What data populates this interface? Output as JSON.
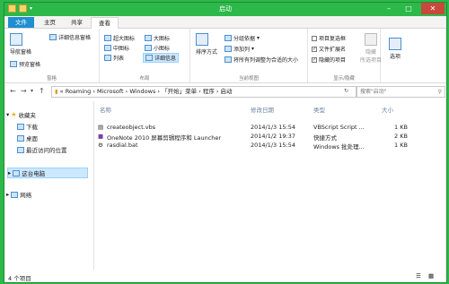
{
  "window": {
    "title": "启动"
  },
  "tabs": [
    "文件",
    "主页",
    "共享",
    "查看"
  ],
  "ribbon": {
    "pane": {
      "nav_pane": "导航窗格",
      "preview": "预览窗格",
      "details": "详细信息窗格",
      "label": "窗格"
    },
    "layout": {
      "items": [
        "超大图标",
        "大图标",
        "中图标",
        "小图标",
        "列表",
        "详细信息"
      ],
      "label": "布局"
    },
    "current_view": {
      "sort": "排序方式",
      "group": "分组依据",
      "add_col": "添加列",
      "fit_cols": "将所有列调整为合适的大小",
      "label": "当前视图"
    },
    "show_hide": {
      "item_checkbox": "项目复选框",
      "ext": "文件扩展名",
      "hidden": "隐藏的项目",
      "hide_selected": "隐藏\n所选项目",
      "label": "显示/隐藏"
    },
    "options": "选项"
  },
  "address": {
    "segments": [
      "Roaming",
      "Microsoft",
      "Windows",
      "「开始」菜单",
      "程序",
      "启动"
    ],
    "search_placeholder": "搜索\"启动\""
  },
  "nav": {
    "favorites": "收藏夹",
    "downloads": "下载",
    "desktop": "桌面",
    "recent": "最近访问的位置",
    "this_pc": "这台电脑",
    "network": "网络"
  },
  "columns": [
    "名称",
    "修改日期",
    "类型",
    "大小"
  ],
  "files": [
    {
      "name": "createobject.vbs",
      "date": "2014/1/3 15:54",
      "type": "VBScript Script ...",
      "size": "1 KB"
    },
    {
      "name": "OneNote 2010 屏幕剪辑程序和 Launcher",
      "date": "2014/1/2 19:37",
      "type": "快捷方式",
      "size": "2 KB"
    },
    {
      "name": "rasdial.bat",
      "date": "2014/1/3 15:54",
      "type": "Windows 批处理...",
      "size": "1 KB"
    }
  ],
  "status": "4 个项目"
}
